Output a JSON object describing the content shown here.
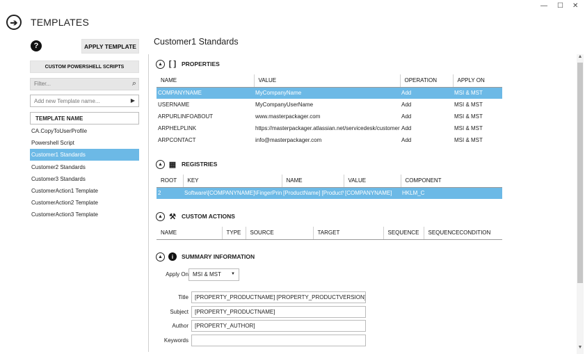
{
  "window": {
    "minimize": "—",
    "maximize": "☐",
    "close": "✕"
  },
  "app": {
    "title": "TEMPLATES",
    "back_icon": "➔"
  },
  "left": {
    "help_icon": "?",
    "apply_template": "APPLY TEMPLATE",
    "custom_ps": "CUSTOM POWERSHELL SCRIPTS",
    "filter_placeholder": "Filter...",
    "filter_icon": "⌕",
    "add_template_placeholder": "Add new Template name...",
    "add_arrow": "▶",
    "template_header": "TEMPLATE NAME",
    "templates": [
      "CA.CopyToUserProfile",
      "Powershell Script",
      "Customer1 Standards",
      "Customer2 Standards",
      "Customer3 Standards",
      "CustomerAction1 Template",
      "CustomerAction2 Template",
      "CustomerAction3 Template"
    ],
    "selected_index": 2
  },
  "main": {
    "title": "Customer1 Standards",
    "collapse_icon": "▲",
    "properties": {
      "title": "PROPERTIES",
      "icon": "[ ]",
      "columns": [
        "NAME",
        "VALUE",
        "OPERATION",
        "APPLY ON"
      ],
      "rows": [
        [
          "COMPANYNAME",
          "MyCompanyName",
          "Add",
          "MSI & MST"
        ],
        [
          "USERNAME",
          "MyCompanyUserName",
          "Add",
          "MSI & MST"
        ],
        [
          "ARPURLINFOABOUT",
          "www.masterpackager.com",
          "Add",
          "MSI & MST"
        ],
        [
          "ARPHELPLINK",
          "https://masterpackager.atlassian.net/servicedesk/customer",
          "Add",
          "MSI & MST"
        ],
        [
          "ARPCONTACT",
          "info@masterpackager.com",
          "Add",
          "MSI & MST"
        ]
      ]
    },
    "registries": {
      "title": "REGISTRIES",
      "icon": "▦",
      "columns": [
        "ROOT",
        "KEY",
        "NAME",
        "VALUE",
        "COMPONENT"
      ],
      "rows": [
        [
          "2",
          "Software\\[COMPANYNAME]\\FingerPrint",
          "[ProductName] [ProductVersion]",
          "[COMPANYNAME]",
          "HKLM_C"
        ]
      ]
    },
    "custom_actions": {
      "title": "CUSTOM ACTIONS",
      "icon": "⚒",
      "columns": [
        "NAME",
        "TYPE",
        "SOURCE",
        "TARGET",
        "SEQUENCE",
        "SEQUENCECONDITION"
      ]
    },
    "summary": {
      "title": "SUMMARY INFORMATION",
      "icon": "i",
      "apply_on_label": "Apply On",
      "apply_on_value": "MSI & MST",
      "select_arrow": "▼",
      "fields": [
        {
          "label": "Title",
          "value": "[PROPERTY_PRODUCTNAME] [PROPERTY_PRODUCTVERSION]"
        },
        {
          "label": "Subject",
          "value": "[PROPERTY_PRODUCTNAME]"
        },
        {
          "label": "Author",
          "value": "[PROPERTY_AUTHOR]"
        },
        {
          "label": "Keywords",
          "value": ""
        }
      ]
    }
  },
  "scrollbar": {
    "up": "▲",
    "down": "▼"
  }
}
